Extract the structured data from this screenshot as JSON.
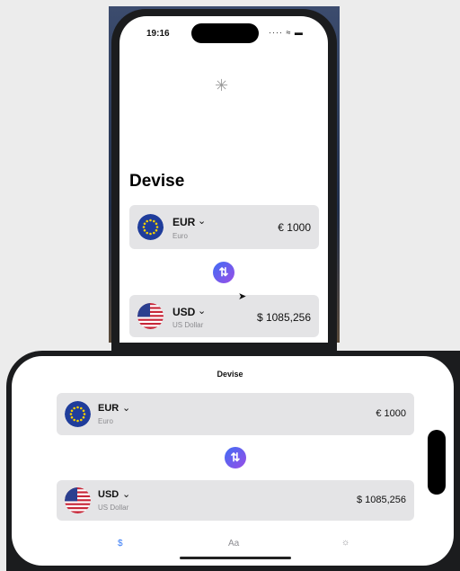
{
  "status": {
    "time": "19:16",
    "icons": "····  ≈ ▬"
  },
  "page_title": "Devise",
  "from_currency": {
    "code": "EUR",
    "name": "Euro",
    "amount": "€ 1000"
  },
  "to_currency": {
    "code": "USD",
    "name": "US Dollar",
    "amount": "$ 1085,256"
  },
  "tabs": [
    {
      "label": "$",
      "icon": "dollar-tab",
      "color": "#3478f6"
    },
    {
      "label": "Aa",
      "icon": "text-tab",
      "color": "#8e8e93"
    },
    {
      "label": "☼",
      "icon": "sun-tab",
      "color": "#8e8e93"
    }
  ],
  "accent": "#3478f6",
  "swap_gradient": [
    "#3f6df5",
    "#9a4ee6"
  ]
}
